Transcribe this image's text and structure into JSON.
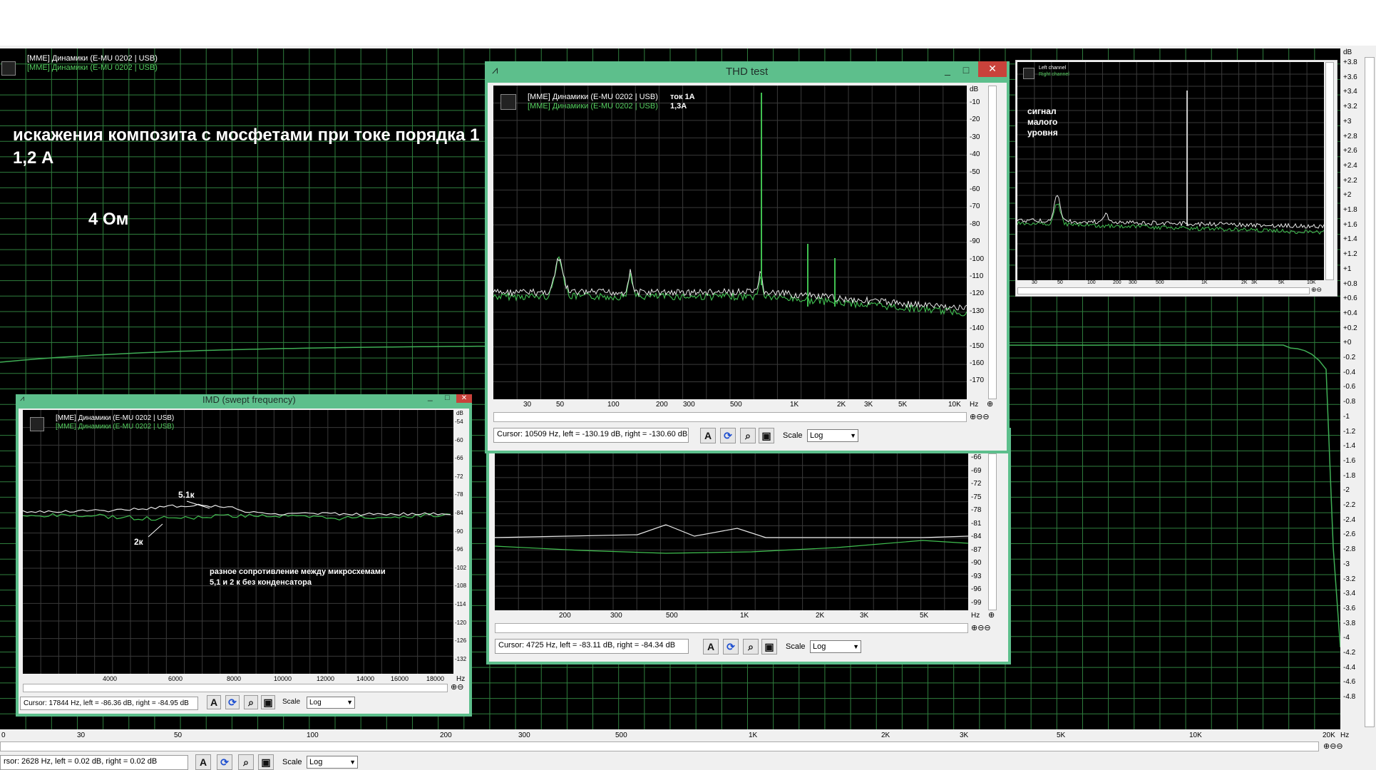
{
  "main": {
    "legend": [
      "[MME] Динамики (E-MU 0202 | USB)",
      "[MME] Динамики (E-MU 0202 | USB)"
    ],
    "annotation_title": "искажения композита с мосфетами при токе порядка 1 - 1,2 А",
    "annotation_ohm": "4 Ом",
    "y_unit": "dB",
    "y_ticks": [
      "+3.8",
      "+3.6",
      "+3.4",
      "+3.2",
      "+3",
      "+2.8",
      "+2.6",
      "+2.4",
      "+2.2",
      "+2",
      "+1.8",
      "+1.6",
      "+1.4",
      "+1.2",
      "+1",
      "+0.8",
      "+0.6",
      "+0.4",
      "+0.2",
      "+0",
      "-0.2",
      "-0.4",
      "-0.6",
      "-0.8",
      "-1",
      "-1.2",
      "-1.4",
      "-1.6",
      "-1.8",
      "-2",
      "-2.2",
      "-2.4",
      "-2.6",
      "-2.8",
      "-3",
      "-3.2",
      "-3.4",
      "-3.6",
      "-3.8",
      "-4",
      "-4.2",
      "-4.4",
      "-4.6",
      "-4.8"
    ],
    "x_ticks": [
      "0",
      "30",
      "50",
      "100",
      "200",
      "300",
      "500",
      "1K",
      "2K",
      "3K",
      "5K",
      "10K",
      "20K"
    ],
    "x_unit": "Hz",
    "cursor": "rsor:  2628 Hz,  left = 0.02 dB,  right = 0.02 dB",
    "scale_label": "Scale",
    "scale_value": "Log"
  },
  "thd_window": {
    "title": "THD test",
    "legend": [
      "[MME] Динамики (E-MU 0202 | USB)",
      "[MME] Динамики (E-MU 0202 | USB)"
    ],
    "legend_notes": [
      "ток 1А",
      "1,3А"
    ],
    "y_unit": "dB",
    "y_ticks": [
      "-10",
      "-20",
      "-30",
      "-40",
      "-50",
      "-60",
      "-70",
      "-80",
      "-90",
      "-100",
      "-110",
      "-120",
      "-130",
      "-140",
      "-150",
      "-160",
      "-170"
    ],
    "x_ticks": [
      "30",
      "50",
      "100",
      "200",
      "300",
      "500",
      "1K",
      "2K",
      "3K",
      "5K",
      "10K"
    ],
    "x_unit": "Hz",
    "cursor": "Cursor:  10509 Hz,  left = -130.19 dB,  right = -130.60 dB",
    "scale_label": "Scale",
    "scale_value": "Log"
  },
  "imd2_window": {
    "y_ticks": [
      "-66",
      "-69",
      "-72",
      "-75",
      "-78",
      "-81",
      "-84",
      "-87",
      "-90",
      "-93",
      "-96",
      "-99"
    ],
    "x_ticks": [
      "200",
      "300",
      "500",
      "1K",
      "2K",
      "3K",
      "5K"
    ],
    "x_unit": "Hz",
    "cursor": "Cursor:  4725 Hz,  left = -83.11 dB,  right = -84.34 dB",
    "scale_label": "Scale",
    "scale_value": "Log"
  },
  "imd_window": {
    "title": "IMD (swept frequency)",
    "legend": [
      "[MME] Динамики (E-MU 0202 | USB)",
      "[MME] Динамики (E-MU 0202 | USB)"
    ],
    "y_unit": "dB",
    "y_ticks": [
      "-54",
      "-60",
      "-66",
      "-72",
      "-78",
      "-84",
      "-90",
      "-96",
      "-102",
      "-108",
      "-114",
      "-120",
      "-126",
      "-132"
    ],
    "x_ticks": [
      "4000",
      "6000",
      "8000",
      "10000",
      "12000",
      "14000",
      "16000",
      "18000"
    ],
    "x_unit": "Hz",
    "label_51k": "5.1к",
    "label_2k": "2к",
    "note": "разное сопротивление между микросхемами 5,1 и 2 к без конденсатора",
    "cursor": "Cursor:  17844 Hz,  left = -86.36 dB,  right = -84.95 dB",
    "scale_label": "Scale",
    "scale_value": "Log"
  },
  "small_window": {
    "legend": [
      "Left channel",
      "Right channel"
    ],
    "note": "сигнал малого уровня",
    "x_ticks": [
      "30",
      "50",
      "100",
      "200",
      "300",
      "500",
      "1K",
      "2K",
      "3K",
      "5K",
      "10K"
    ]
  }
}
